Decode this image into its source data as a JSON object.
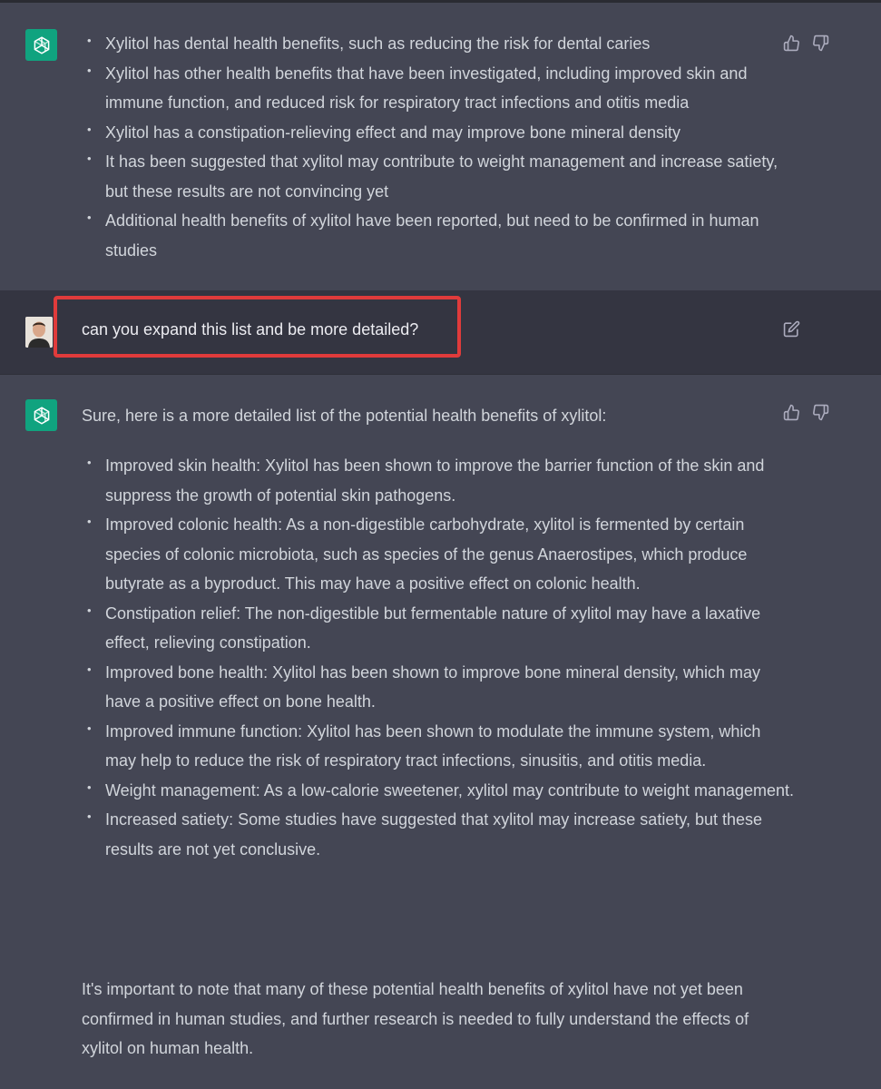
{
  "prev_response": {
    "bullets": [
      "Xylitol has dental health benefits, such as reducing the risk for dental caries",
      "Xylitol has other health benefits that have been investigated, including improved skin and immune function, and reduced risk for respiratory tract infections and otitis media",
      "Xylitol has a constipation-relieving effect and may improve bone mineral density",
      "It has been suggested that xylitol may contribute to weight management and increase satiety, but these results are not convincing yet",
      "Additional health benefits of xylitol have been reported, but need to be confirmed in human studies"
    ]
  },
  "user_message": {
    "text": "can you expand this list and be more detailed?"
  },
  "response": {
    "intro": "Sure, here is a more detailed list of the potential health benefits of xylitol:",
    "bullets": [
      "Improved skin health: Xylitol has been shown to improve the barrier function of the skin and suppress the growth of potential skin pathogens.",
      "Improved colonic health: As a non-digestible carbohydrate, xylitol is fermented by certain species of colonic microbiota, such as species of the genus Anaerostipes, which produce butyrate as a byproduct. This may have a positive effect on colonic health.",
      "Constipation relief: The non-digestible but fermentable nature of xylitol may have a laxative effect, relieving constipation.",
      "Improved bone health: Xylitol has been shown to improve bone mineral density, which may have a positive effect on bone health.",
      "Improved immune function: Xylitol has been shown to modulate the immune system, which may help to reduce the risk of respiratory tract infections, sinusitis, and otitis media.",
      "Weight management: As a low-calorie sweetener, xylitol may contribute to weight management.",
      "Increased satiety: Some studies have suggested that xylitol may increase satiety, but these results are not yet conclusive."
    ],
    "closing": "It's important to note that many of these potential health benefits of xylitol have not yet been confirmed in human studies, and further research is needed to fully understand the effects of xylitol on human health."
  },
  "icons": {
    "assistant_avatar": "openai-logo-icon",
    "thumbs_up": "thumbs-up-icon",
    "thumbs_down": "thumbs-down-icon",
    "edit": "edit-icon"
  },
  "colors": {
    "assistant_bg": "#444654",
    "user_bg": "#343541",
    "accent": "#10a37f",
    "highlight": "#e03b3b",
    "text": "#d1d5db"
  }
}
